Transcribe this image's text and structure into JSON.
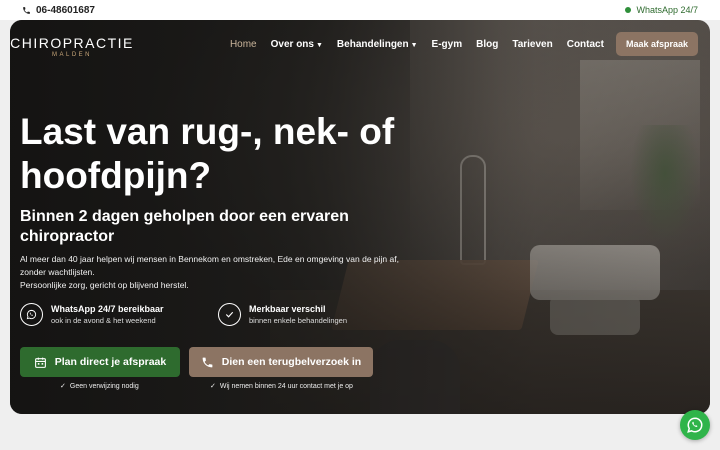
{
  "topbar": {
    "phone": "06-48601687",
    "whatsapp": "WhatsApp 24/7"
  },
  "logo": {
    "main": "CHIROPRACTIE",
    "sub": "MALDEN"
  },
  "nav": {
    "items": [
      {
        "label": "Home",
        "active": true
      },
      {
        "label": "Over ons",
        "dropdown": true
      },
      {
        "label": "Behandelingen",
        "dropdown": true
      },
      {
        "label": "E-gym"
      },
      {
        "label": "Blog"
      },
      {
        "label": "Tarieven"
      },
      {
        "label": "Contact"
      }
    ],
    "cta": "Maak afspraak"
  },
  "hero": {
    "title": "Last van rug-, nek- of hoofdpijn?",
    "subtitle": "Binnen 2 dagen geholpen door een ervaren chiropractor",
    "intro_line1": "Al meer dan 40 jaar helpen wij mensen in Bennekom en omstreken, Ede en omgeving van de pijn af, zonder wachtlijsten.",
    "intro_line2": "Persoonlijke zorg, gericht op blijvend herstel.",
    "features": [
      {
        "title": "WhatsApp 24/7 bereikbaar",
        "sub": "ook in de avond & het weekend",
        "icon": "whatsapp-icon"
      },
      {
        "title": "Merkbaar verschil",
        "sub": "binnen enkele behandelingen",
        "icon": "check-icon"
      }
    ],
    "btn_primary": "Plan direct je afspraak",
    "btn_secondary": "Dien een terugbelverzoek in",
    "note_primary": "Geen verwijzing nodig",
    "note_secondary": "Wij nemen binnen 24 uur contact met je op"
  },
  "colors": {
    "green": "#2e6b2e",
    "brown": "#8c7463",
    "whatsapp": "#2fb44a"
  }
}
